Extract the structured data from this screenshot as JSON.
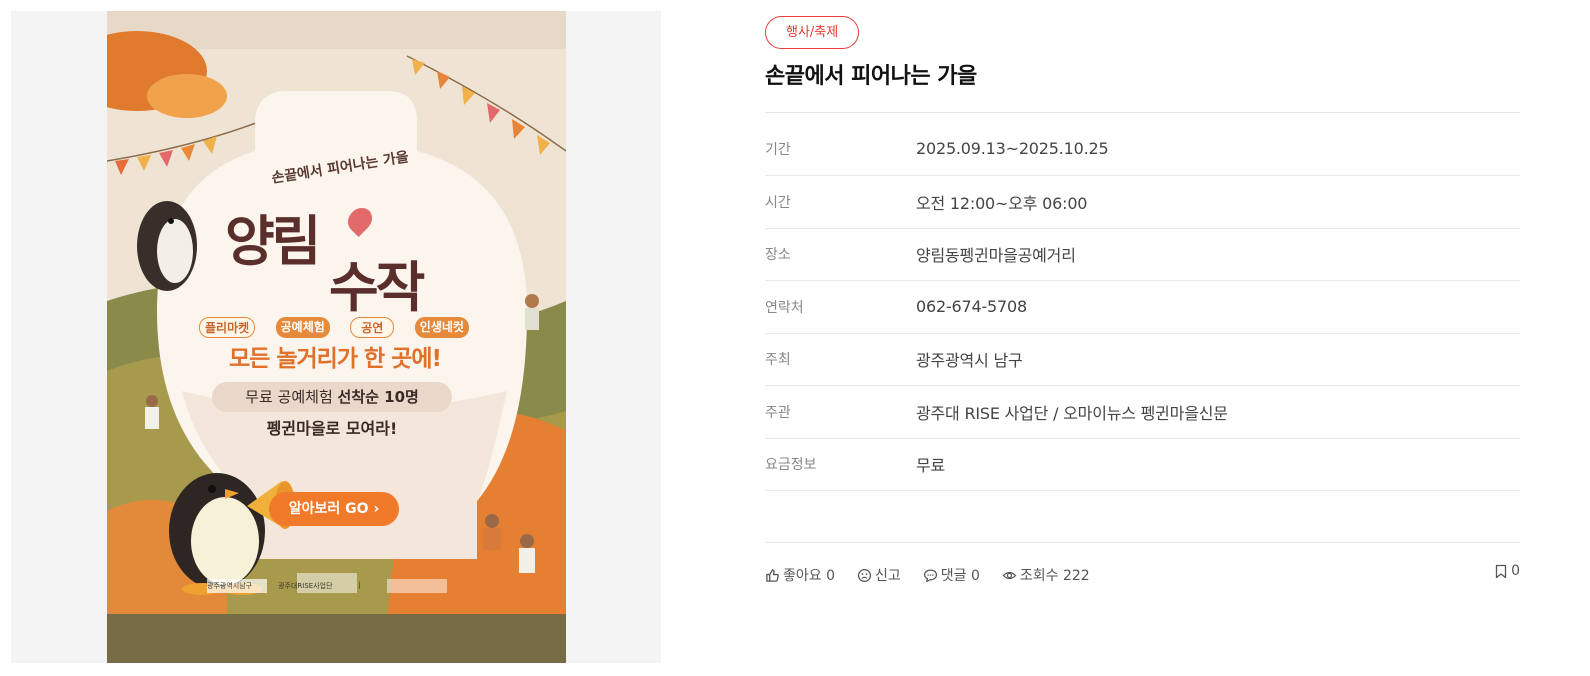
{
  "poster": {
    "subtitle": "손끝에서 피어나는 가을",
    "headline_top": "양림",
    "headline_bottom": "수작",
    "tags": [
      "플리마켓",
      "공예체험",
      "공연",
      "인생네컷"
    ],
    "tagline": "모든 놀거리가 한 곳에!",
    "free_offer_prefix": "무료 공예체험 ",
    "free_offer_strong": "선착순 10명",
    "gather": "펭귄마을로 모여라!",
    "cta": "알아보러 GO",
    "sponsors": [
      "광주광역시남구",
      "광주대RISE사업단",
      "|"
    ]
  },
  "event": {
    "category": "행사/축제",
    "title": "손끝에서 피어나는 가을",
    "details": [
      {
        "label": "기간",
        "value": "2025.09.13~2025.10.25"
      },
      {
        "label": "시간",
        "value": "오전 12:00~오후 06:00"
      },
      {
        "label": "장소",
        "value": "양림동펭귄마을공예거리"
      },
      {
        "label": "연락처",
        "value": "062-674-5708"
      },
      {
        "label": "주최",
        "value": "광주광역시 남구"
      },
      {
        "label": "주관",
        "value": "광주대 RISE 사업단 / 오마이뉴스 펭귄마을신문"
      },
      {
        "label": "요금정보",
        "value": "무료"
      }
    ]
  },
  "actions": {
    "like": "좋아요 0",
    "report": "신고",
    "comment": "댓글 0",
    "views": "조회수 222",
    "bookmark": "0"
  }
}
